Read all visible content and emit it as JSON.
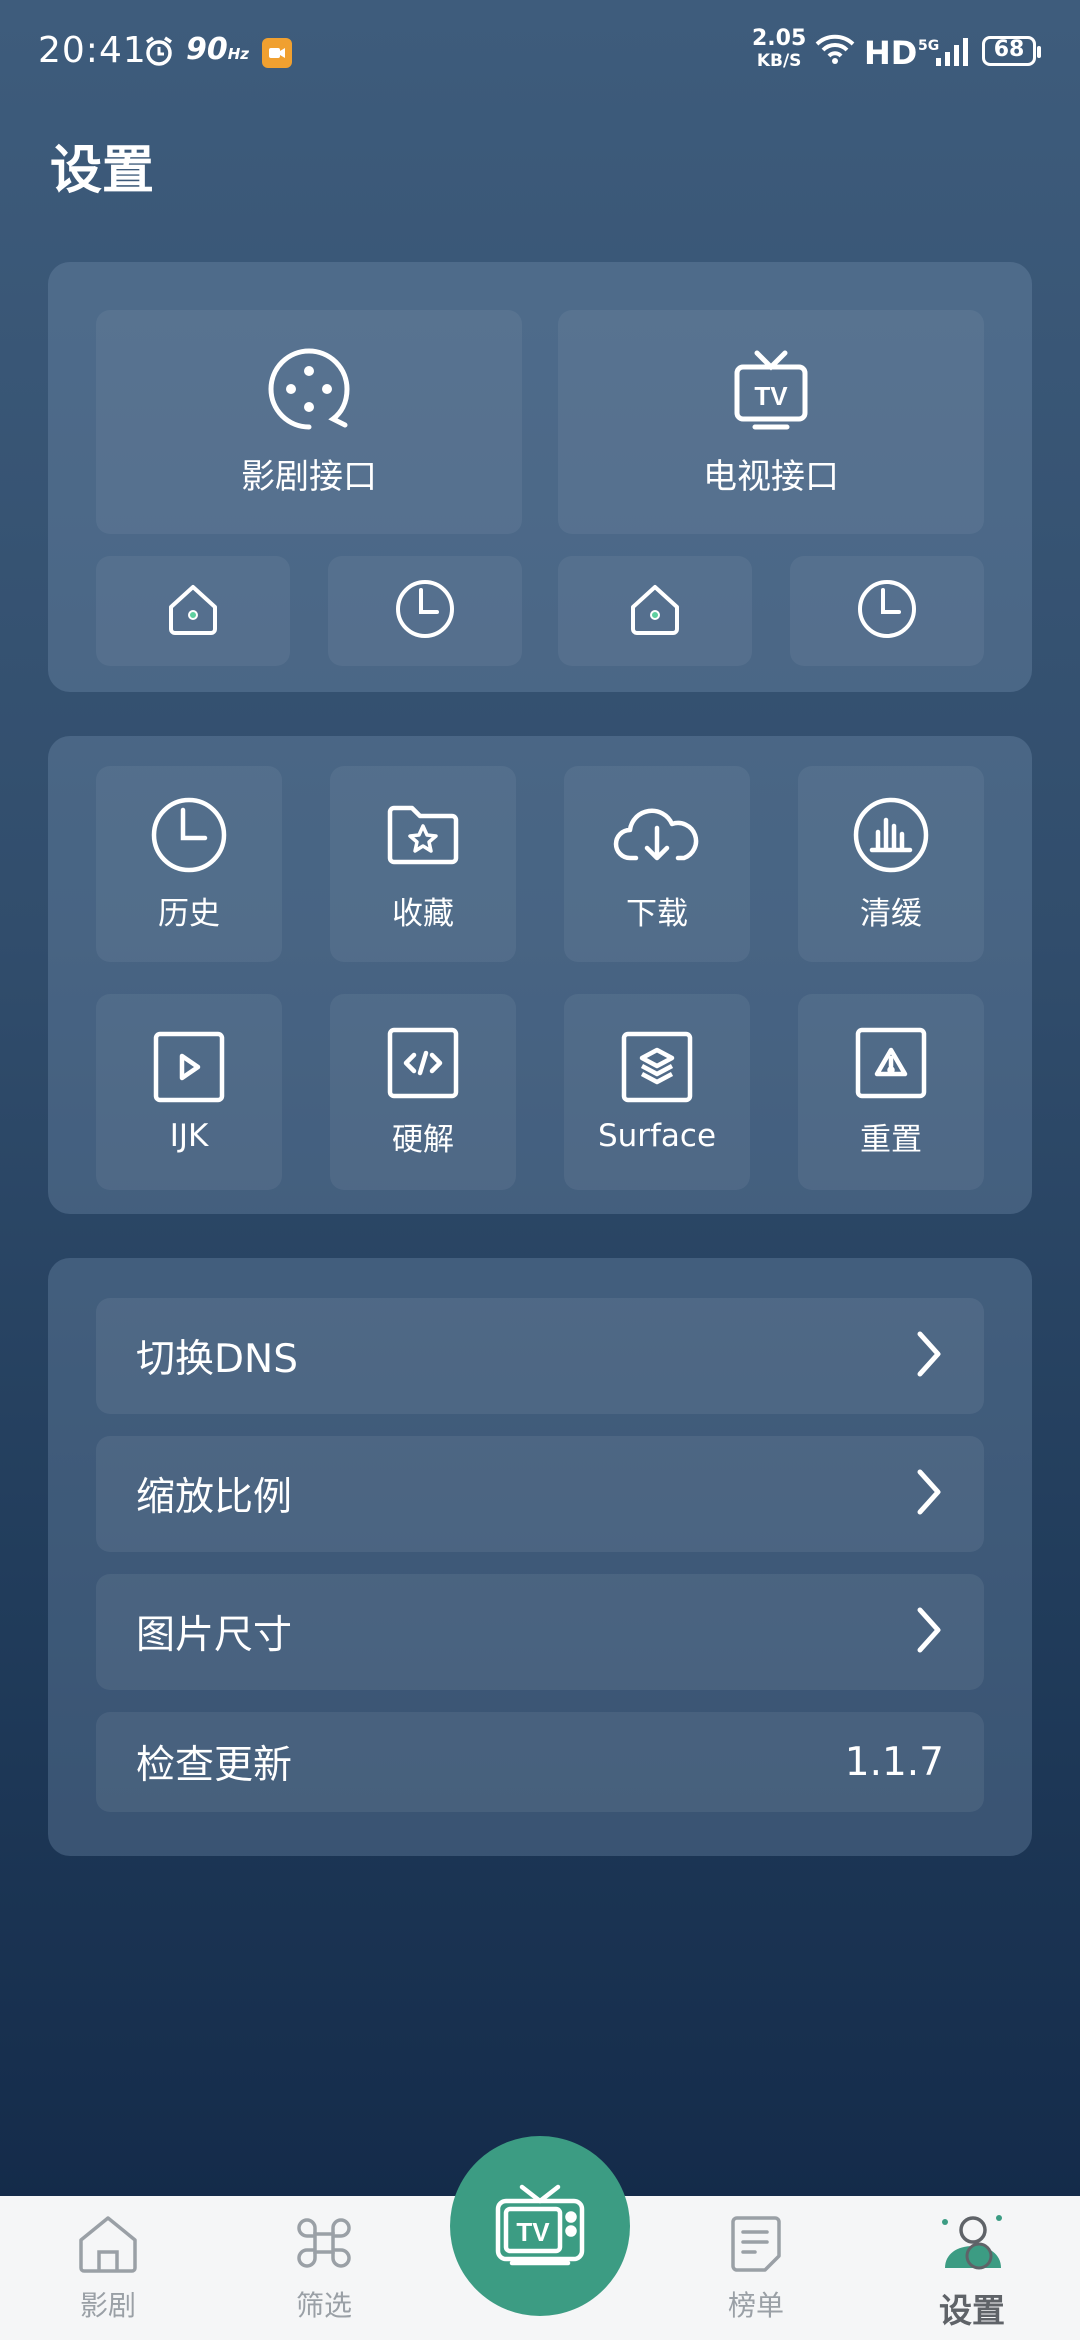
{
  "status_bar": {
    "time": "20:41",
    "refresh_rate": "90",
    "refresh_unit": "Hz",
    "net_speed": "2.05",
    "net_unit": "KB/S",
    "hd": "HD",
    "network": "5G",
    "battery": "68"
  },
  "page": {
    "title": "设置"
  },
  "interfaces": {
    "movie_label": "影剧接口",
    "tv_label": "电视接口",
    "movie_icon": "film-reel-icon",
    "tv_icon": "tv-icon"
  },
  "grid": {
    "items": [
      {
        "label": "历史",
        "icon": "clock-icon"
      },
      {
        "label": "收藏",
        "icon": "folder-star-icon"
      },
      {
        "label": "下载",
        "icon": "cloud-download-icon"
      },
      {
        "label": "清缓",
        "icon": "chart-circle-icon"
      },
      {
        "label": "IJK",
        "icon": "play-box-icon"
      },
      {
        "label": "硬解",
        "icon": "code-box-icon"
      },
      {
        "label": "Surface",
        "icon": "layers-box-icon"
      },
      {
        "label": "重置",
        "icon": "warning-box-icon"
      }
    ]
  },
  "settings": {
    "rows": [
      {
        "label": "切换DNS"
      },
      {
        "label": "缩放比例"
      },
      {
        "label": "图片尺寸"
      },
      {
        "label": "检查更新",
        "value": "1.1.7"
      }
    ]
  },
  "bottom_nav": {
    "items": [
      {
        "label": "影剧",
        "icon": "home-icon"
      },
      {
        "label": "筛选",
        "icon": "command-icon"
      },
      {
        "label": "榜单",
        "icon": "document-icon"
      },
      {
        "label": "设置",
        "icon": "user-settings-icon"
      }
    ],
    "center_icon": "tv-icon",
    "center_text": "TV"
  },
  "colors": {
    "accent": "#3c9c83",
    "background_top": "#3e5c7c",
    "background_bottom": "#112746"
  }
}
